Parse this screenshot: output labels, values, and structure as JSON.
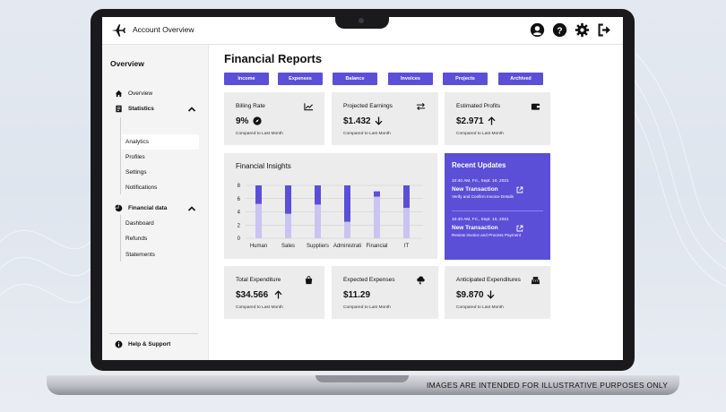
{
  "app": {
    "title": "Account Overview"
  },
  "header_icons": [
    "user-circle-icon",
    "help-circle-icon",
    "gear-icon",
    "logout-icon"
  ],
  "sidebar": {
    "title": "Overview",
    "items": [
      {
        "label": "Overview",
        "icon": "home-icon"
      },
      {
        "label": "Statistics",
        "icon": "document-icon",
        "expanded": true,
        "children": [
          "Analytics",
          "Profiles",
          "Settings",
          "Notifications"
        ],
        "active": "Analytics"
      },
      {
        "label": "Financial data",
        "icon": "pie-chart-icon",
        "expanded": true,
        "children": [
          "Dashboard",
          "Refunds",
          "Statements"
        ]
      }
    ],
    "footer": {
      "label": "Help & Support",
      "icon": "info-icon"
    }
  },
  "main": {
    "title": "Financial Reports",
    "tabs": [
      "Income",
      "Expenses",
      "Balance",
      "Invoices",
      "Projects",
      "Archived"
    ],
    "top_cards": [
      {
        "label": "Billing Rate",
        "value": "9%",
        "sub": "Compared to Last Month",
        "icon": "trend-chart-icon",
        "badge": "compass-icon"
      },
      {
        "label": "Projected Earnings",
        "value": "$1.432",
        "sub": "Compared to Last Month",
        "icon": "swap-arrows-icon",
        "arrow": "down"
      },
      {
        "label": "Estimated Profits",
        "value": "$2.971",
        "sub": "Compared to Last Month",
        "icon": "wallet-icon",
        "arrow": "up"
      }
    ],
    "bottom_cards": [
      {
        "label": "Total Expenditure",
        "value": "$34.566",
        "sub": "Compared to Last Month",
        "icon": "bag-icon",
        "arrow": "up"
      },
      {
        "label": "Expected Expenses",
        "value": "$11.29",
        "sub": "Compared to Last Month",
        "icon": "storm-cloud-icon"
      },
      {
        "label": "Anticipated Expenditures",
        "value": "$9.870",
        "sub": "Compared to Last Month",
        "icon": "register-icon",
        "arrow": "down"
      }
    ],
    "insights": {
      "title": "Financial Insights"
    },
    "updates": {
      "title": "Recent Updates",
      "items": [
        {
          "time": "10:40 AM, Fri., Sept. 10, 2021",
          "title": "New Transaction",
          "desc": "Verify and Confirm Invoice Details"
        },
        {
          "time": "10:40 AM, Fri., Sept. 10, 2021",
          "title": "New Transaction",
          "desc": "Review Invoice and Process Payment"
        }
      ]
    }
  },
  "chart_data": {
    "type": "bar",
    "stacked": true,
    "categories": [
      "Human",
      "Sales",
      "Suppliers",
      "Administrati",
      "Financial",
      "IT"
    ],
    "series": [
      {
        "values": [
          5.2,
          3.7,
          5.1,
          2.5,
          6.3,
          4.6
        ],
        "color": "#c9c4f2"
      },
      {
        "values": [
          2.8,
          4.3,
          2.9,
          5.5,
          0.8,
          3.4
        ],
        "color": "#5b4fd8"
      }
    ],
    "ylim": [
      0,
      8
    ],
    "yticks": [
      0,
      2,
      4,
      6,
      8
    ],
    "grid": true
  },
  "disclaimer": "IMAGES ARE INTENDED FOR ILLUSTRATIVE PURPOSES ONLY"
}
